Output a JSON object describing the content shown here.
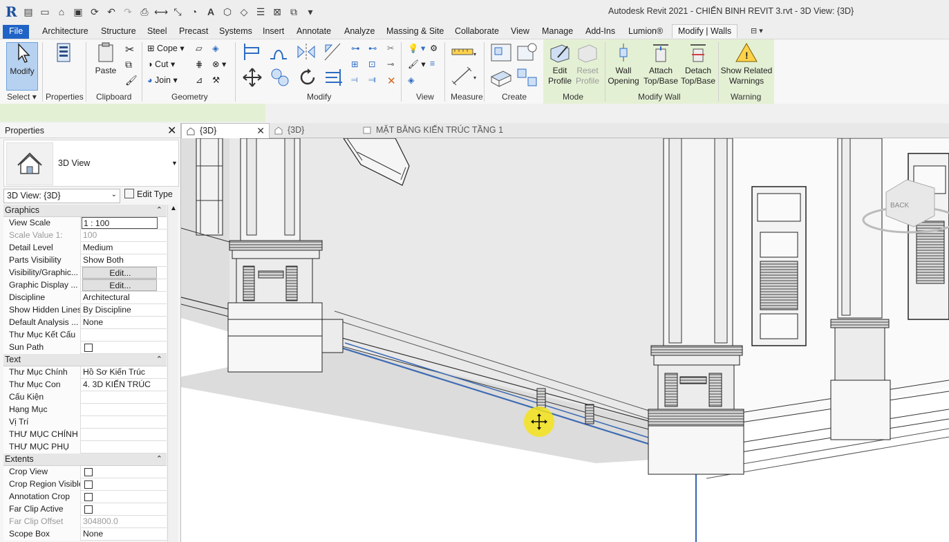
{
  "app": {
    "logo": "R",
    "title": "Autodesk Revit 2021 - CHIẾN BINH REVIT 3.rvt - 3D View: {3D}"
  },
  "quick_access": [
    "open-icon",
    "new-icon",
    "save-icon",
    "sync-icon",
    "undo-icon",
    "redo-icon",
    "print-icon",
    "measure-icon",
    "text-icon",
    "default-3d-icon",
    "thin-lines-icon",
    "close-hidden-icon",
    "switch-windows-icon"
  ],
  "menu": {
    "tabs": [
      "File",
      "Architecture",
      "Structure",
      "Steel",
      "Precast",
      "Systems",
      "Insert",
      "Annotate",
      "Analyze",
      "Massing & Site",
      "Collaborate",
      "View",
      "Manage",
      "Add-Ins",
      "Lumion®",
      "Modify | Walls"
    ],
    "active": "Modify | Walls"
  },
  "ribbon": {
    "select": {
      "modify": "Modify",
      "label": "Select"
    },
    "properties": {
      "label": "Properties"
    },
    "clipboard": {
      "paste": "Paste",
      "label": "Clipboard"
    },
    "geometry": {
      "cope": "Cope",
      "cut": "Cut",
      "join": "Join",
      "label": "Geometry"
    },
    "modify": {
      "label": "Modify"
    },
    "view": {
      "label": "View"
    },
    "measure": {
      "label": "Measure"
    },
    "create": {
      "label": "Create"
    },
    "mode": {
      "edit_profile_1": "Edit",
      "edit_profile_2": "Profile",
      "reset_profile_1": "Reset",
      "reset_profile_2": "Profile",
      "label": "Mode"
    },
    "modify_wall": {
      "wall_opening_1": "Wall",
      "wall_opening_2": "Opening",
      "attach_1": "Attach",
      "attach_2": "Top/Base",
      "detach_1": "Detach",
      "detach_2": "Top/Base",
      "label": "Modify Wall"
    },
    "warning": {
      "show_1": "Show Related",
      "show_2": "Warnings",
      "label": "Warning"
    }
  },
  "properties": {
    "title": "Properties",
    "type_name": "3D View",
    "instance": "3D View: {3D}",
    "edit_type": "Edit Type",
    "groups": [
      {
        "name": "Graphics",
        "rows": [
          {
            "k": "View Scale",
            "v": "1 : 100",
            "kind": "boxed"
          },
          {
            "k": "Scale Value    1:",
            "v": "100",
            "kind": "dim"
          },
          {
            "k": "Detail Level",
            "v": "Medium"
          },
          {
            "k": "Parts Visibility",
            "v": "Show Both"
          },
          {
            "k": "Visibility/Graphic...",
            "v": "Edit...",
            "kind": "btn"
          },
          {
            "k": "Graphic Display ...",
            "v": "Edit...",
            "kind": "btn"
          },
          {
            "k": "Discipline",
            "v": "Architectural"
          },
          {
            "k": "Show Hidden Lines",
            "v": "By Discipline"
          },
          {
            "k": "Default Analysis ...",
            "v": "None"
          },
          {
            "k": "Thư Mục Kết Cấu",
            "v": ""
          },
          {
            "k": "Sun Path",
            "v": "",
            "kind": "chk"
          }
        ]
      },
      {
        "name": "Text",
        "rows": [
          {
            "k": "Thư Mục Chính",
            "v": "Hồ Sơ Kiến Trúc"
          },
          {
            "k": "Thư Mục Con",
            "v": "4. 3D KIẾN TRÚC"
          },
          {
            "k": "Cấu Kiện",
            "v": ""
          },
          {
            "k": "Hạng Mục",
            "v": ""
          },
          {
            "k": "Vị Trí",
            "v": ""
          },
          {
            "k": "THƯ MỤC CHÍNH",
            "v": ""
          },
          {
            "k": "THƯ MỤC PHỤ",
            "v": ""
          }
        ]
      },
      {
        "name": "Extents",
        "rows": [
          {
            "k": "Crop View",
            "v": "",
            "kind": "chk"
          },
          {
            "k": "Crop Region Visible",
            "v": "",
            "kind": "chk"
          },
          {
            "k": "Annotation Crop",
            "v": "",
            "kind": "chk"
          },
          {
            "k": "Far Clip Active",
            "v": "",
            "kind": "chk"
          },
          {
            "k": "Far Clip Offset",
            "v": "304800.0",
            "kind": "dim"
          },
          {
            "k": "Scope Box",
            "v": "None"
          }
        ]
      }
    ]
  },
  "view_tabs": [
    {
      "label": "{3D}",
      "active": true
    },
    {
      "label": "{3D}",
      "active": false
    },
    {
      "label": "MẶT BẰNG KIẾN TRÚC TẦNG 1",
      "active": false
    }
  ],
  "viewcube": {
    "face_label": "BACK"
  },
  "colors": {
    "file_tab": "#1f63c6",
    "context_tab": "#e4f0d4",
    "selection": "#3d6bb3",
    "cursor_highlight": "#f5e31a"
  }
}
